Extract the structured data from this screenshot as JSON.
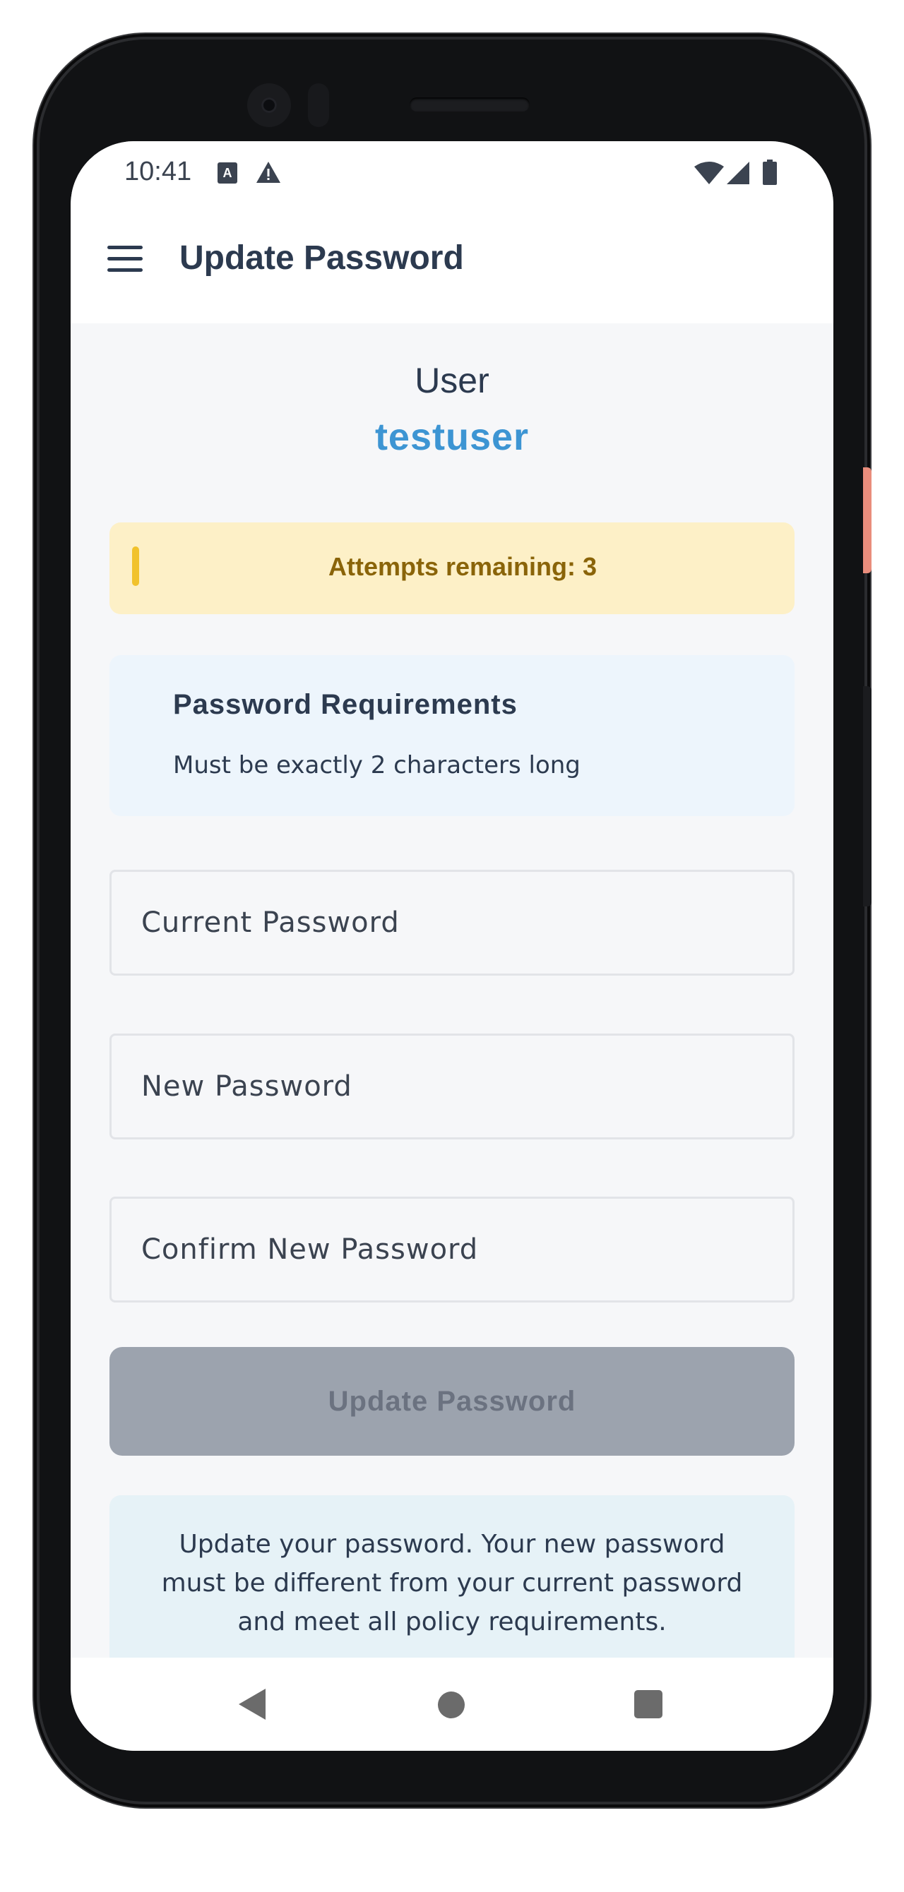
{
  "status_bar": {
    "time": "10:41",
    "left_icons": [
      "text-a-icon",
      "warning-icon"
    ],
    "right_icons": [
      "wifi-icon",
      "signal-icon",
      "battery-icon"
    ]
  },
  "app_bar": {
    "title": "Update Password",
    "menu_icon": "hamburger-menu-icon"
  },
  "user": {
    "label": "User",
    "username": "testuser"
  },
  "attempts": {
    "text": "Attempts remaining: 3"
  },
  "requirements": {
    "title": "Password Requirements",
    "text": "Must be exactly 2 characters long"
  },
  "form": {
    "current_password_placeholder": "Current Password",
    "new_password_placeholder": "New Password",
    "confirm_password_placeholder": "Confirm New Password",
    "submit_label": "Update Password"
  },
  "info": {
    "text": "Update your password. Your new password must be different from your current password and meet all policy requirements."
  },
  "nav_bar": {
    "icons": [
      "back-icon",
      "home-icon",
      "recents-icon"
    ]
  },
  "colors": {
    "accent": "#3d95d3",
    "title_text": "#2c3a4f",
    "warning_bg": "#fdf0c7",
    "warning_text": "#8a6409",
    "warning_bar": "#f1c22c",
    "requirements_bg": "#edf5fc",
    "info_bg": "#e6f2f7",
    "disabled_button": "#9ca3ae"
  }
}
